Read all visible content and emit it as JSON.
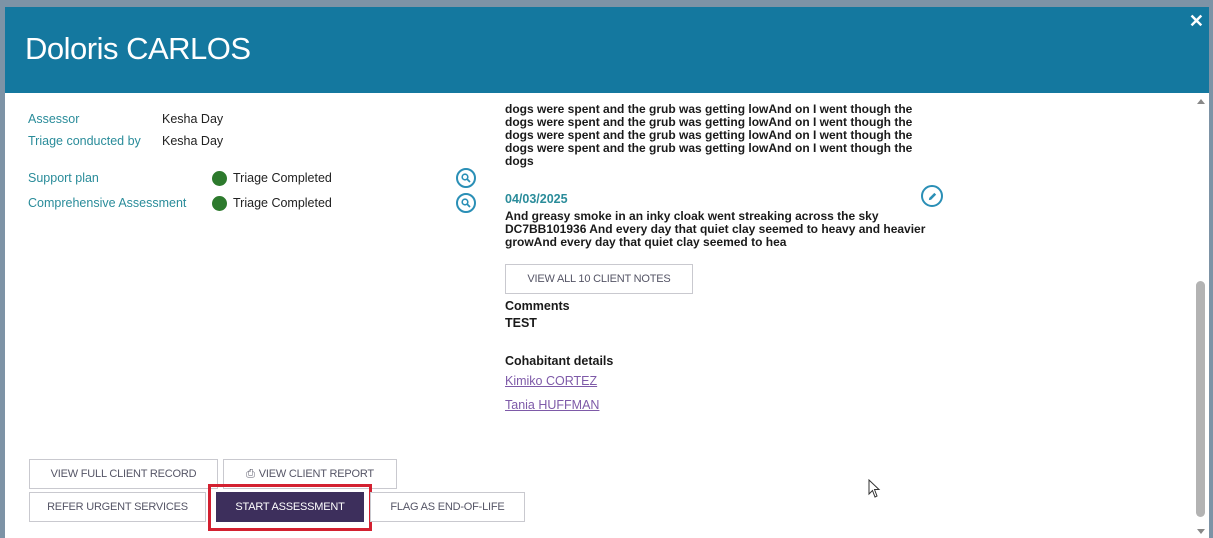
{
  "header": {
    "title": "Doloris CARLOS",
    "close_icon": "close-icon"
  },
  "details": {
    "assessor_label": "Assessor",
    "assessor_value": "Kesha Day",
    "triage_label": "Triage conducted by",
    "triage_value": "Kesha Day",
    "support_plan_label": "Support plan",
    "support_plan_status": "Triage Completed",
    "comprehensive_label": "Comprehensive Assessment",
    "comprehensive_status": "Triage Completed",
    "status_color": "#2d7a2d"
  },
  "notes": {
    "previous_lines": [
      "dogs were spent and the grub was getting lowAnd on I went though the",
      "dogs were spent and the grub was getting lowAnd on I went though the",
      "dogs were spent and the grub was getting lowAnd on I went though the",
      "dogs were spent and the grub was getting lowAnd on I went though the",
      "dogs"
    ],
    "latest_date": "04/03/2025",
    "latest_lines": [
      "And greasy smoke in an inky cloak went streaking across the sky",
      "DC7BB101936 And every day that quiet clay seemed to heavy and heavier",
      "growAnd every day that quiet clay seemed to hea"
    ],
    "view_all_label": "VIEW ALL 10 CLIENT NOTES"
  },
  "comments": {
    "title": "Comments",
    "value": "TEST"
  },
  "cohabitants": {
    "title": "Cohabitant details",
    "names": [
      "Kimiko CORTEZ",
      "Tania HUFFMAN"
    ]
  },
  "actions": {
    "view_full_record": "VIEW FULL CLIENT RECORD",
    "view_client_report": "VIEW CLIENT REPORT",
    "refer_urgent": "REFER URGENT SERVICES",
    "start_assessment": "START ASSESSMENT",
    "flag_end_of_life": "FLAG AS END-OF-LIFE"
  },
  "colors": {
    "header": "#14789f",
    "accent": "#2a8c9a",
    "primary_button": "#3d2f5c",
    "highlight": "#d32030",
    "link": "#7e5aa8"
  }
}
